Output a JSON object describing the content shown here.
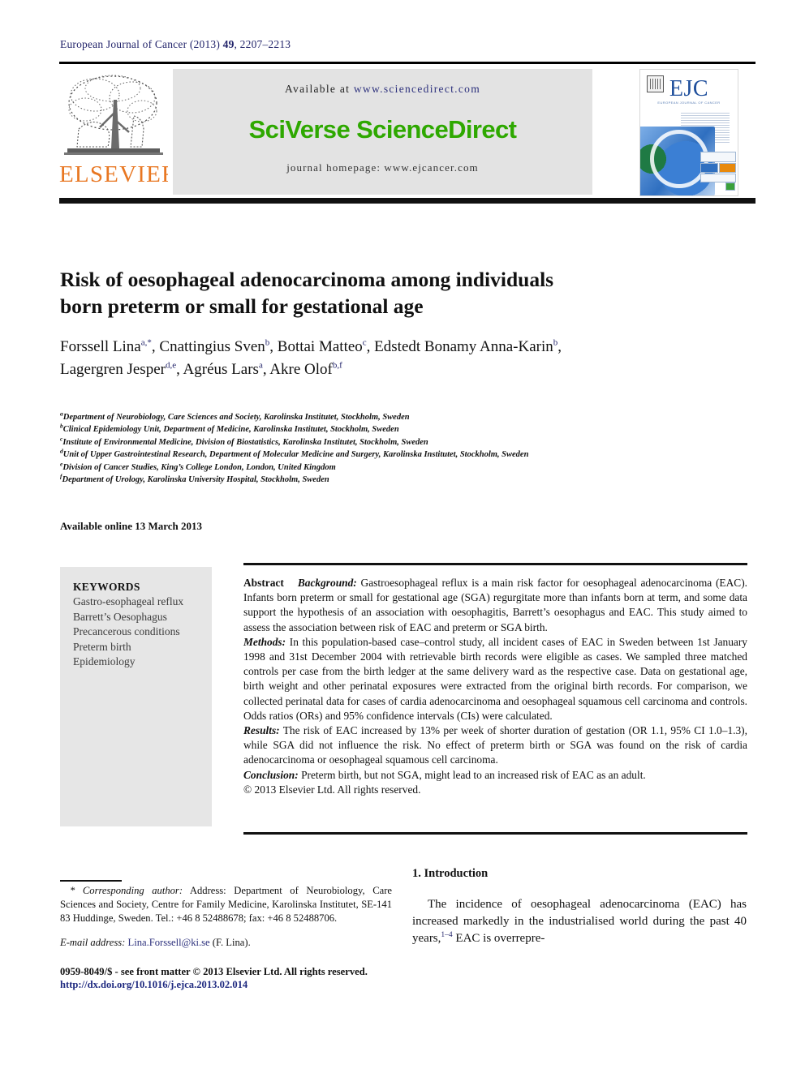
{
  "running_head": {
    "journal": "European Journal of Cancer",
    "year": "(2013)",
    "volume": "49",
    "pages": ", 2207–2213"
  },
  "header": {
    "publisher_logo_text": "ELSEVIER",
    "publisher_logo_icon": "elsevier-tree-icon",
    "available_prefix": "Available at ",
    "available_url": "www.sciencedirect.com",
    "sciencedirect_logo": "SciVerse ScienceDirect",
    "journal_homepage": "journal homepage: www.ejcancer.com",
    "cover": {
      "title": "EJC",
      "subtitle": "EUROPEAN JOURNAL OF CANCER",
      "alt": "ejc-journal-cover-image"
    },
    "colors": {
      "elsevier_orange": "#e87722",
      "sciencedirect_green": "#2ea800",
      "link_blue": "#2b2f7c",
      "ejc_blue": "#1f4f9c",
      "panel_grey": "#e3e3e3"
    }
  },
  "article": {
    "title_line1": "Risk of oesophageal adenocarcinoma among individuals",
    "title_line2": "born preterm or small for gestational age",
    "authors": [
      {
        "name": "Forssell Lina",
        "marks": "a,*",
        "sep": ", "
      },
      {
        "name": "Cnattingius Sven",
        "marks": "b",
        "sep": ", "
      },
      {
        "name": "Bottai Matteo",
        "marks": "c",
        "sep": ", "
      },
      {
        "name": "Edstedt Bonamy Anna-Karin",
        "marks": "b",
        "sep": ", "
      },
      {
        "name": "Lagergren Jesper",
        "marks": "d,e",
        "sep": ", "
      },
      {
        "name": "Agréus Lars",
        "marks": "a",
        "sep": ", "
      },
      {
        "name": "Akre Olof",
        "marks": "b,f",
        "sep": ""
      }
    ],
    "affiliations": [
      {
        "mark": "a",
        "text": "Department of Neurobiology, Care Sciences and Society, Karolinska Institutet, Stockholm, Sweden"
      },
      {
        "mark": "b",
        "text": "Clinical Epidemiology Unit, Department of Medicine, Karolinska Institutet, Stockholm, Sweden"
      },
      {
        "mark": "c",
        "text": "Institute of Environmental Medicine, Division of Biostatistics, Karolinska Institutet, Stockholm, Sweden"
      },
      {
        "mark": "d",
        "text": "Unit of Upper Gastrointestinal Research, Department of Molecular Medicine and Surgery, Karolinska Institutet, Stockholm, Sweden"
      },
      {
        "mark": "e",
        "text": "Division of Cancer Studies, King’s College London, London, United Kingdom"
      },
      {
        "mark": "f",
        "text": "Department of Urology, Karolinska University Hospital, Stockholm, Sweden"
      }
    ],
    "available_online": "Available online 13 March 2013"
  },
  "keywords": {
    "heading": "KEYWORDS",
    "items": [
      "Gastro-esophageal reflux",
      "Barrett’s Oesophagus",
      "Precancerous conditions",
      "Preterm birth",
      "Epidemiology"
    ]
  },
  "abstract": {
    "label": "Abstract",
    "background_label": "Background:",
    "background_text": " Gastroesophageal reflux is a main risk factor for oesophageal adenocarcinoma (EAC). Infants born preterm or small for gestational age (SGA) regurgitate more than infants born at term, and some data support the hypothesis of an association with oesophagitis, Barrett’s oesophagus and EAC. This study aimed to assess the association between risk of EAC and preterm or SGA birth.",
    "methods_label": "Methods:",
    "methods_text": " In this population-based case–control study, all incident cases of EAC in Sweden between 1st January 1998 and 31st December 2004 with retrievable birth records were eligible as cases. We sampled three matched controls per case from the birth ledger at the same delivery ward as the respective case. Data on gestational age, birth weight and other perinatal exposures were extracted from the original birth records. For comparison, we collected perinatal data for cases of cardia adenocarcinoma and oesophageal squamous cell carcinoma and controls. Odds ratios (ORs) and 95% confidence intervals (CIs) were calculated.",
    "results_label": "Results:",
    "results_text": " The risk of EAC increased by 13% per week of shorter duration of gestation (OR 1.1, 95% CI 1.0–1.3), while SGA did not influence the risk. No effect of preterm birth or SGA was found on the risk of cardia adenocarcinoma or oesophageal squamous cell carcinoma.",
    "conclusion_label": "Conclusion:",
    "conclusion_text": " Preterm birth, but not SGA, might lead to an increased risk of EAC as an adult.",
    "copyright": "© 2013 Elsevier Ltd. All rights reserved."
  },
  "footnote": {
    "corresponding_label": "* Corresponding author:",
    "corresponding_text": " Address: Department of Neurobiology, Care Sciences and Society, Centre for Family Medicine, Karolinska Institutet, SE-141 83 Huddinge, Sweden. Tel.: +46 8 52488678; fax: +46 8 52488706.",
    "email_label": "E-mail address:",
    "email_address": "Lina.Forssell@ki.se",
    "email_suffix": " (F. Lina).",
    "issn_line": "0959-8049/$ - see front matter © 2013 Elsevier Ltd. All rights reserved.",
    "doi_line": "http://dx.doi.org/10.1016/j.ejca.2013.02.014"
  },
  "introduction": {
    "heading": "1. Introduction",
    "paragraph_part1": "The incidence of oesophageal adenocarcinoma (EAC) has increased markedly in the industrialised world during the past 40 years,",
    "citation": "1–4",
    "paragraph_part2": " EAC is overrepre-"
  }
}
